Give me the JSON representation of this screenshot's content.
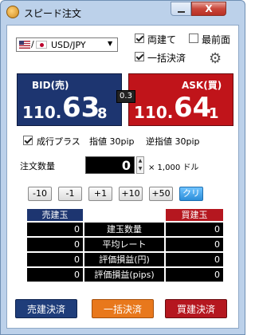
{
  "window": {
    "title": "スピード注文",
    "close_glyph": "X"
  },
  "pair": {
    "flag_base": "us-flag-icon",
    "flag_quote": "jp-flag-icon",
    "separator": "/",
    "label": "USD/JPY"
  },
  "options": {
    "hedge": {
      "label": "両建て",
      "checked": true
    },
    "always_on_top": {
      "label": "最前面",
      "checked": false
    },
    "bulk_settle": {
      "label": "一括決済",
      "checked": true
    }
  },
  "bid": {
    "label": "BID(売)",
    "price_int": "110.",
    "price_big": "63",
    "price_small": "8"
  },
  "ask": {
    "label": "ASK(買)",
    "price_int": "110.",
    "price_big": "64",
    "price_small": "1"
  },
  "spread": "0.3",
  "market_plus": {
    "label": "成行プラス",
    "checked": true,
    "limit_text": "指値 30pip",
    "stop_text": "逆指値 30pip"
  },
  "quantity": {
    "label": "注文数量",
    "value": "0",
    "unit": "× 1,000 ドル"
  },
  "quick_buttons": [
    "-10",
    "-1",
    "+1",
    "+10",
    "+50",
    "クリア"
  ],
  "positions": {
    "sell_header": "売建玉",
    "buy_header": "買建玉",
    "rows": [
      {
        "label": "建玉数量",
        "sell": "0",
        "buy": "0"
      },
      {
        "label": "平均レート",
        "sell": "0",
        "buy": "0"
      },
      {
        "label": "評価損益(円)",
        "sell": "0",
        "buy": "0"
      },
      {
        "label": "評価損益(pips)",
        "sell": "0",
        "buy": "0"
      }
    ]
  },
  "actions": {
    "sell_settle": "売建決済",
    "bulk_settle": "一括決済",
    "buy_settle": "買建決済"
  },
  "colors": {
    "bid": "#1d3570",
    "ask": "#c0141a",
    "clear": "#2c8ed9",
    "sell_btn": "#1f3d7a",
    "bulk_btn": "#e8781c",
    "buy_btn": "#b5171f"
  }
}
